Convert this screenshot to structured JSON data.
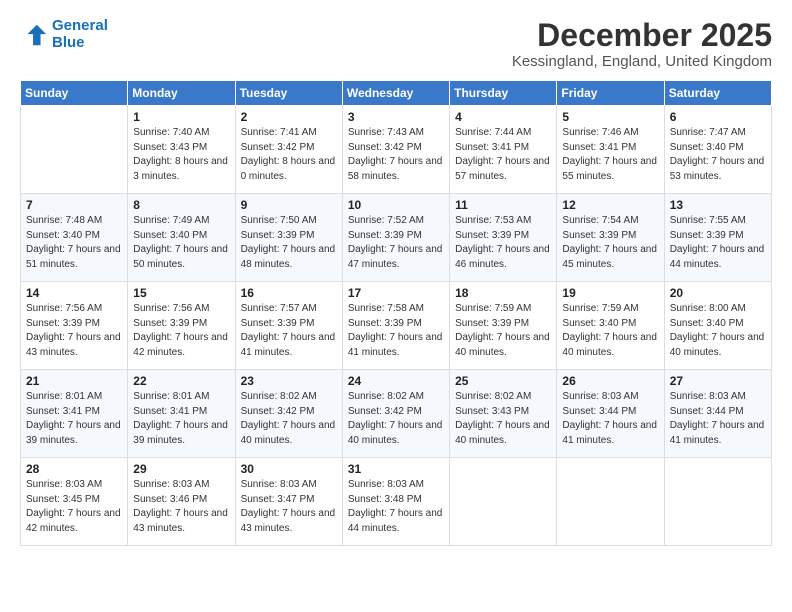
{
  "logo": {
    "line1": "General",
    "line2": "Blue"
  },
  "title": "December 2025",
  "subtitle": "Kessingland, England, United Kingdom",
  "days_header": [
    "Sunday",
    "Monday",
    "Tuesday",
    "Wednesday",
    "Thursday",
    "Friday",
    "Saturday"
  ],
  "weeks": [
    [
      {
        "day": "",
        "sunrise": "",
        "sunset": "",
        "daylight": ""
      },
      {
        "day": "1",
        "sunrise": "Sunrise: 7:40 AM",
        "sunset": "Sunset: 3:43 PM",
        "daylight": "Daylight: 8 hours and 3 minutes."
      },
      {
        "day": "2",
        "sunrise": "Sunrise: 7:41 AM",
        "sunset": "Sunset: 3:42 PM",
        "daylight": "Daylight: 8 hours and 0 minutes."
      },
      {
        "day": "3",
        "sunrise": "Sunrise: 7:43 AM",
        "sunset": "Sunset: 3:42 PM",
        "daylight": "Daylight: 7 hours and 58 minutes."
      },
      {
        "day": "4",
        "sunrise": "Sunrise: 7:44 AM",
        "sunset": "Sunset: 3:41 PM",
        "daylight": "Daylight: 7 hours and 57 minutes."
      },
      {
        "day": "5",
        "sunrise": "Sunrise: 7:46 AM",
        "sunset": "Sunset: 3:41 PM",
        "daylight": "Daylight: 7 hours and 55 minutes."
      },
      {
        "day": "6",
        "sunrise": "Sunrise: 7:47 AM",
        "sunset": "Sunset: 3:40 PM",
        "daylight": "Daylight: 7 hours and 53 minutes."
      }
    ],
    [
      {
        "day": "7",
        "sunrise": "Sunrise: 7:48 AM",
        "sunset": "Sunset: 3:40 PM",
        "daylight": "Daylight: 7 hours and 51 minutes."
      },
      {
        "day": "8",
        "sunrise": "Sunrise: 7:49 AM",
        "sunset": "Sunset: 3:40 PM",
        "daylight": "Daylight: 7 hours and 50 minutes."
      },
      {
        "day": "9",
        "sunrise": "Sunrise: 7:50 AM",
        "sunset": "Sunset: 3:39 PM",
        "daylight": "Daylight: 7 hours and 48 minutes."
      },
      {
        "day": "10",
        "sunrise": "Sunrise: 7:52 AM",
        "sunset": "Sunset: 3:39 PM",
        "daylight": "Daylight: 7 hours and 47 minutes."
      },
      {
        "day": "11",
        "sunrise": "Sunrise: 7:53 AM",
        "sunset": "Sunset: 3:39 PM",
        "daylight": "Daylight: 7 hours and 46 minutes."
      },
      {
        "day": "12",
        "sunrise": "Sunrise: 7:54 AM",
        "sunset": "Sunset: 3:39 PM",
        "daylight": "Daylight: 7 hours and 45 minutes."
      },
      {
        "day": "13",
        "sunrise": "Sunrise: 7:55 AM",
        "sunset": "Sunset: 3:39 PM",
        "daylight": "Daylight: 7 hours and 44 minutes."
      }
    ],
    [
      {
        "day": "14",
        "sunrise": "Sunrise: 7:56 AM",
        "sunset": "Sunset: 3:39 PM",
        "daylight": "Daylight: 7 hours and 43 minutes."
      },
      {
        "day": "15",
        "sunrise": "Sunrise: 7:56 AM",
        "sunset": "Sunset: 3:39 PM",
        "daylight": "Daylight: 7 hours and 42 minutes."
      },
      {
        "day": "16",
        "sunrise": "Sunrise: 7:57 AM",
        "sunset": "Sunset: 3:39 PM",
        "daylight": "Daylight: 7 hours and 41 minutes."
      },
      {
        "day": "17",
        "sunrise": "Sunrise: 7:58 AM",
        "sunset": "Sunset: 3:39 PM",
        "daylight": "Daylight: 7 hours and 41 minutes."
      },
      {
        "day": "18",
        "sunrise": "Sunrise: 7:59 AM",
        "sunset": "Sunset: 3:39 PM",
        "daylight": "Daylight: 7 hours and 40 minutes."
      },
      {
        "day": "19",
        "sunrise": "Sunrise: 7:59 AM",
        "sunset": "Sunset: 3:40 PM",
        "daylight": "Daylight: 7 hours and 40 minutes."
      },
      {
        "day": "20",
        "sunrise": "Sunrise: 8:00 AM",
        "sunset": "Sunset: 3:40 PM",
        "daylight": "Daylight: 7 hours and 40 minutes."
      }
    ],
    [
      {
        "day": "21",
        "sunrise": "Sunrise: 8:01 AM",
        "sunset": "Sunset: 3:41 PM",
        "daylight": "Daylight: 7 hours and 39 minutes."
      },
      {
        "day": "22",
        "sunrise": "Sunrise: 8:01 AM",
        "sunset": "Sunset: 3:41 PM",
        "daylight": "Daylight: 7 hours and 39 minutes."
      },
      {
        "day": "23",
        "sunrise": "Sunrise: 8:02 AM",
        "sunset": "Sunset: 3:42 PM",
        "daylight": "Daylight: 7 hours and 40 minutes."
      },
      {
        "day": "24",
        "sunrise": "Sunrise: 8:02 AM",
        "sunset": "Sunset: 3:42 PM",
        "daylight": "Daylight: 7 hours and 40 minutes."
      },
      {
        "day": "25",
        "sunrise": "Sunrise: 8:02 AM",
        "sunset": "Sunset: 3:43 PM",
        "daylight": "Daylight: 7 hours and 40 minutes."
      },
      {
        "day": "26",
        "sunrise": "Sunrise: 8:03 AM",
        "sunset": "Sunset: 3:44 PM",
        "daylight": "Daylight: 7 hours and 41 minutes."
      },
      {
        "day": "27",
        "sunrise": "Sunrise: 8:03 AM",
        "sunset": "Sunset: 3:44 PM",
        "daylight": "Daylight: 7 hours and 41 minutes."
      }
    ],
    [
      {
        "day": "28",
        "sunrise": "Sunrise: 8:03 AM",
        "sunset": "Sunset: 3:45 PM",
        "daylight": "Daylight: 7 hours and 42 minutes."
      },
      {
        "day": "29",
        "sunrise": "Sunrise: 8:03 AM",
        "sunset": "Sunset: 3:46 PM",
        "daylight": "Daylight: 7 hours and 43 minutes."
      },
      {
        "day": "30",
        "sunrise": "Sunrise: 8:03 AM",
        "sunset": "Sunset: 3:47 PM",
        "daylight": "Daylight: 7 hours and 43 minutes."
      },
      {
        "day": "31",
        "sunrise": "Sunrise: 8:03 AM",
        "sunset": "Sunset: 3:48 PM",
        "daylight": "Daylight: 7 hours and 44 minutes."
      },
      {
        "day": "",
        "sunrise": "",
        "sunset": "",
        "daylight": ""
      },
      {
        "day": "",
        "sunrise": "",
        "sunset": "",
        "daylight": ""
      },
      {
        "day": "",
        "sunrise": "",
        "sunset": "",
        "daylight": ""
      }
    ]
  ]
}
